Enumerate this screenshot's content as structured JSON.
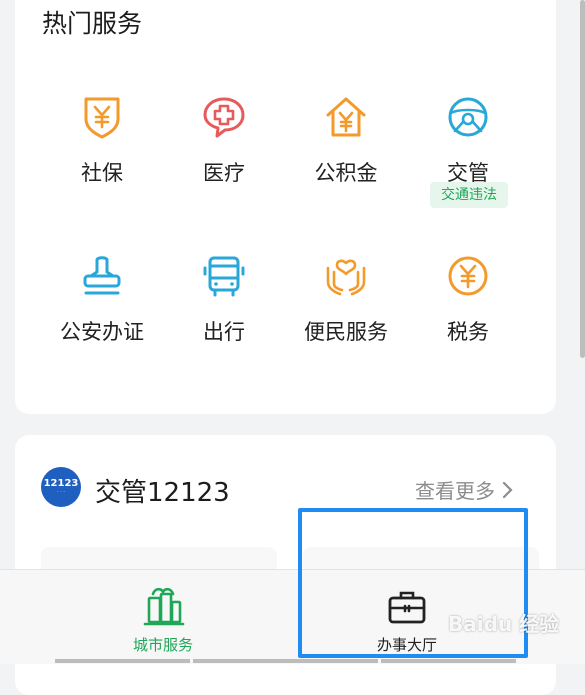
{
  "hot_services": {
    "title": "热门服务",
    "items": [
      {
        "label": "社保",
        "icon": "shield-yen-icon",
        "color": "#f39a2b"
      },
      {
        "label": "医疗",
        "icon": "medical-cross-icon",
        "color": "#e85a5a"
      },
      {
        "label": "公积金",
        "icon": "house-yen-icon",
        "color": "#f39a2b"
      },
      {
        "label": "交管",
        "icon": "steering-wheel-icon",
        "color": "#28a7d8",
        "badge": "交通违法"
      },
      {
        "label": "公安办证",
        "icon": "stamp-icon",
        "color": "#28a7d8"
      },
      {
        "label": "出行",
        "icon": "bus-icon",
        "color": "#28a7d8"
      },
      {
        "label": "便民服务",
        "icon": "heart-hands-icon",
        "color": "#f39a2b"
      },
      {
        "label": "税务",
        "icon": "yen-coin-icon",
        "color": "#f39a2b"
      }
    ]
  },
  "jiaoguan": {
    "title": "交管12123",
    "logo_text": "12123",
    "more_label": "查看更多"
  },
  "tabbar": {
    "tabs": [
      {
        "label": "城市服务",
        "icon": "city-buildings-icon",
        "active": true,
        "color": "#1ea757"
      },
      {
        "label": "办事大厅",
        "icon": "briefcase-icon",
        "active": false,
        "color": "#222222"
      }
    ]
  },
  "watermark": "Baidu 经验",
  "colors": {
    "accent": "#1ea757",
    "highlight": "#1e8cf2",
    "orange": "#f39a2b",
    "blue": "#28a7d8",
    "red": "#e85a5a"
  }
}
